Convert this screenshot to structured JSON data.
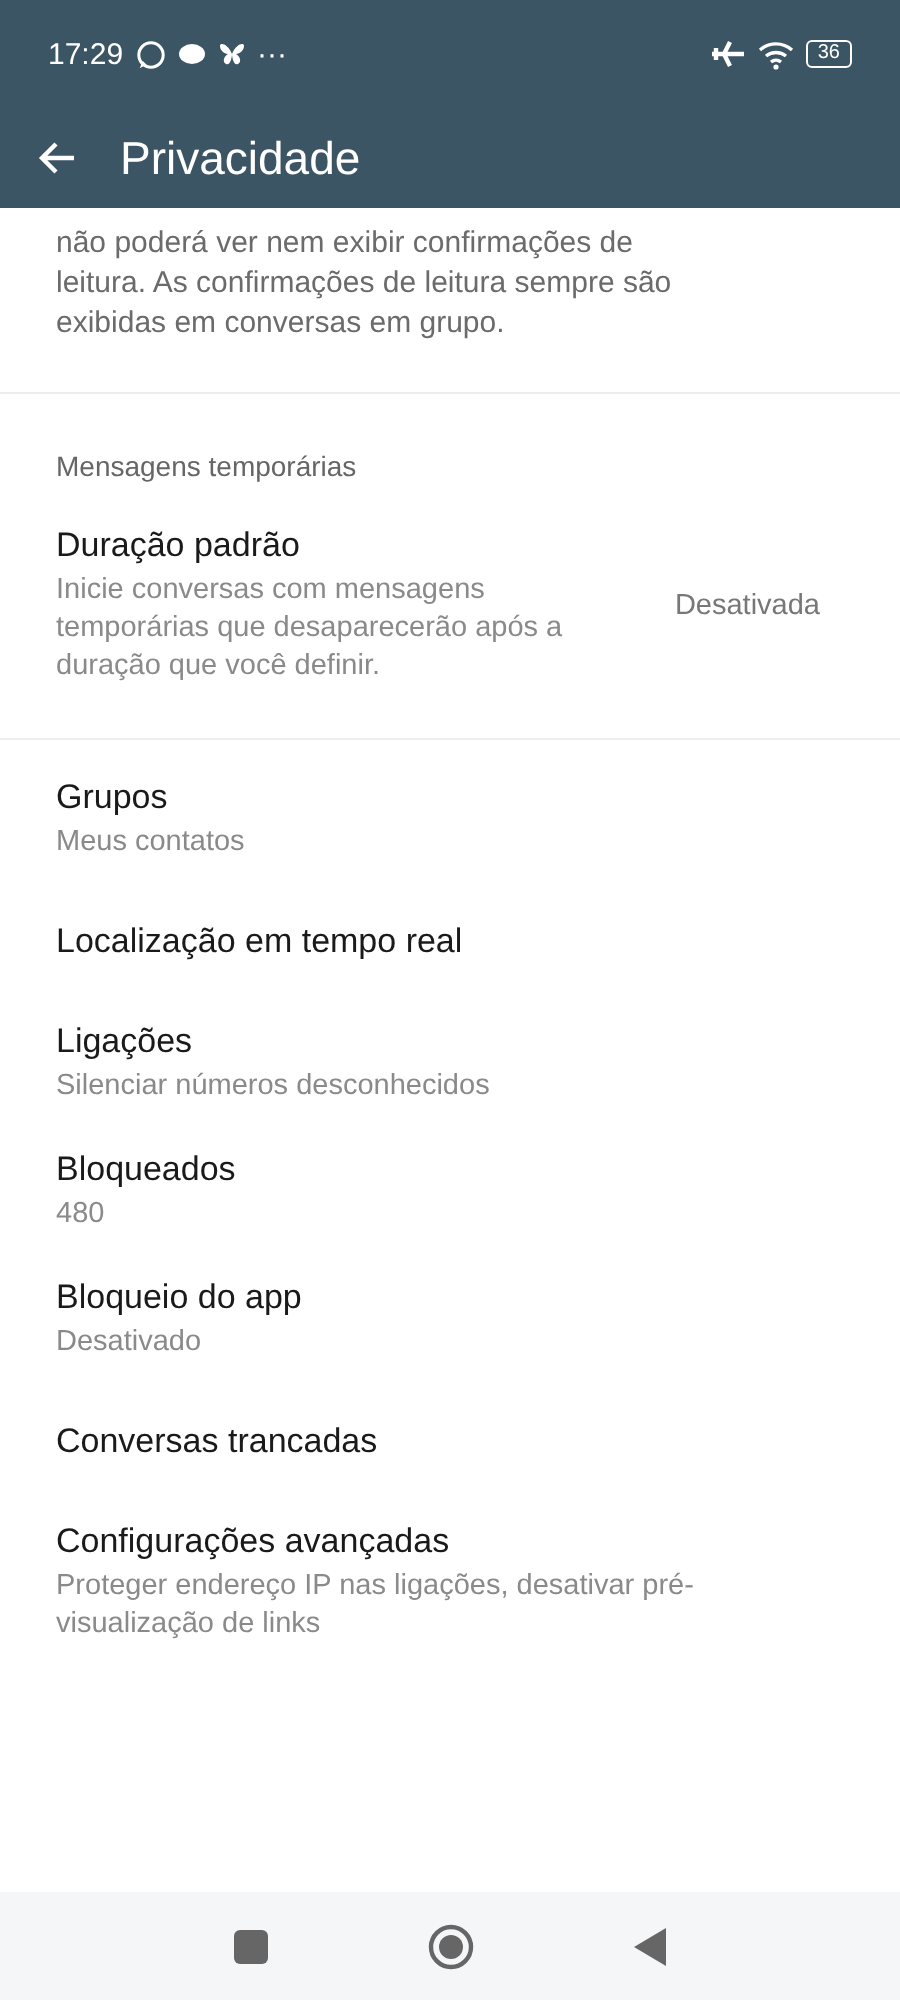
{
  "status_bar": {
    "time": "17:29",
    "more": "···",
    "battery": "36"
  },
  "header": {
    "title": "Privacidade"
  },
  "intro_text": "não poderá ver nem exibir confirmações de leitura. As confirmações de leitura sempre são exibidas em conversas em grupo.",
  "sections": [
    {
      "heading": "Mensagens temporárias",
      "items": [
        {
          "title": "Duração padrão",
          "subtitle": "Inicie conversas com mensagens temporárias que desaparecerão após a duração que você definir.",
          "value": "Desativada"
        }
      ]
    },
    {
      "items": [
        {
          "title": "Grupos",
          "subtitle": "Meus contatos"
        },
        {
          "title": "Localização em tempo real"
        },
        {
          "title": "Ligações",
          "subtitle": "Silenciar números desconhecidos"
        },
        {
          "title": "Bloqueados",
          "subtitle": "480"
        },
        {
          "title": "Bloqueio do app",
          "subtitle": "Desativado"
        },
        {
          "title": "Conversas trancadas"
        },
        {
          "title": "Configurações avançadas",
          "subtitle": "Proteger endereço IP nas ligações, desativar pré-visualização de links"
        }
      ]
    }
  ]
}
